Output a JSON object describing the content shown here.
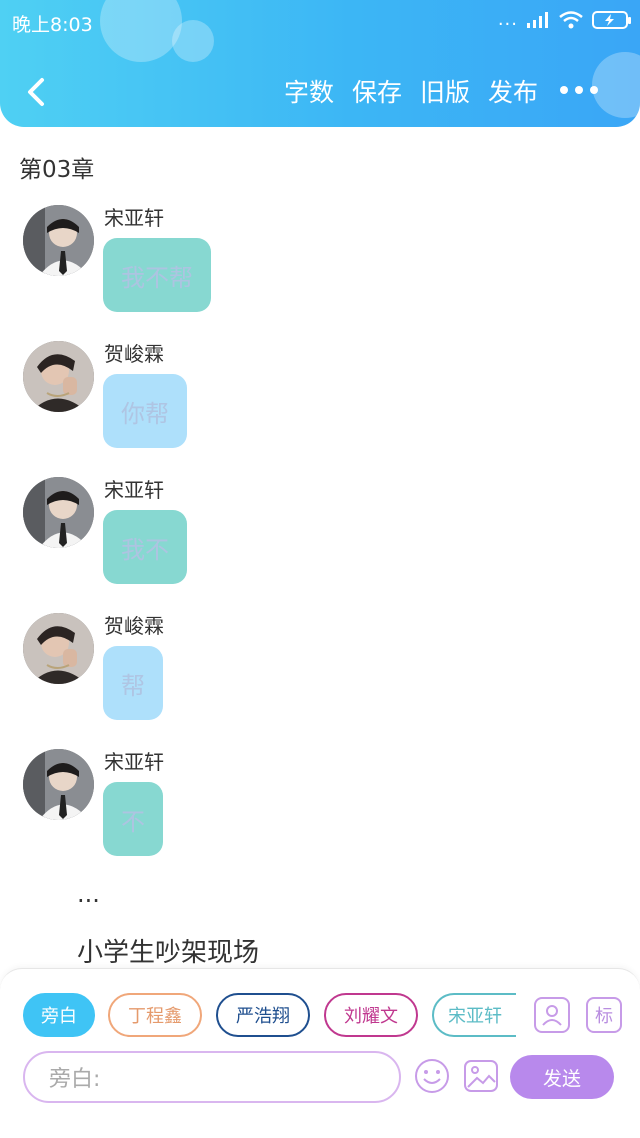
{
  "status_bar": {
    "time": "晚上8:03",
    "signal_dots": "...",
    "battery_icon": "battery-charging-icon"
  },
  "header": {
    "back_icon": "chevron-left-icon",
    "actions": [
      "字数",
      "保存",
      "旧版",
      "发布"
    ],
    "more_icon": "more-horizontal-icon",
    "accent_color": "#3cb6f5"
  },
  "chapter": {
    "title": "第03章"
  },
  "messages": [
    {
      "speaker": "宋亚轩",
      "text": "我不帮",
      "style": "teal"
    },
    {
      "speaker": "贺峻霖",
      "text": "你帮",
      "style": "blue"
    },
    {
      "speaker": "宋亚轩",
      "text": "我不",
      "style": "teal"
    },
    {
      "speaker": "贺峻霖",
      "text": "帮",
      "style": "blue"
    },
    {
      "speaker": "宋亚轩",
      "text": "不",
      "style": "teal"
    }
  ],
  "narration": {
    "ellipsis": "...",
    "text": "小学生吵架现场"
  },
  "composer": {
    "roles": [
      "旁白",
      "丁程鑫",
      "严浩翔",
      "刘耀文",
      "宋亚轩"
    ],
    "active_role": "旁白",
    "role_colors": [
      "#3fc4f5",
      "#f0a77a",
      "#1f4f8f",
      "#c0388f",
      "#5cbcc6"
    ],
    "profile_icon": "user-card-icon",
    "tag_label": "标",
    "input_placeholder": "旁白:",
    "emoji_icon": "smiley-icon",
    "image_icon": "image-icon",
    "send_label": "发送",
    "send_color": "#b889ec"
  }
}
